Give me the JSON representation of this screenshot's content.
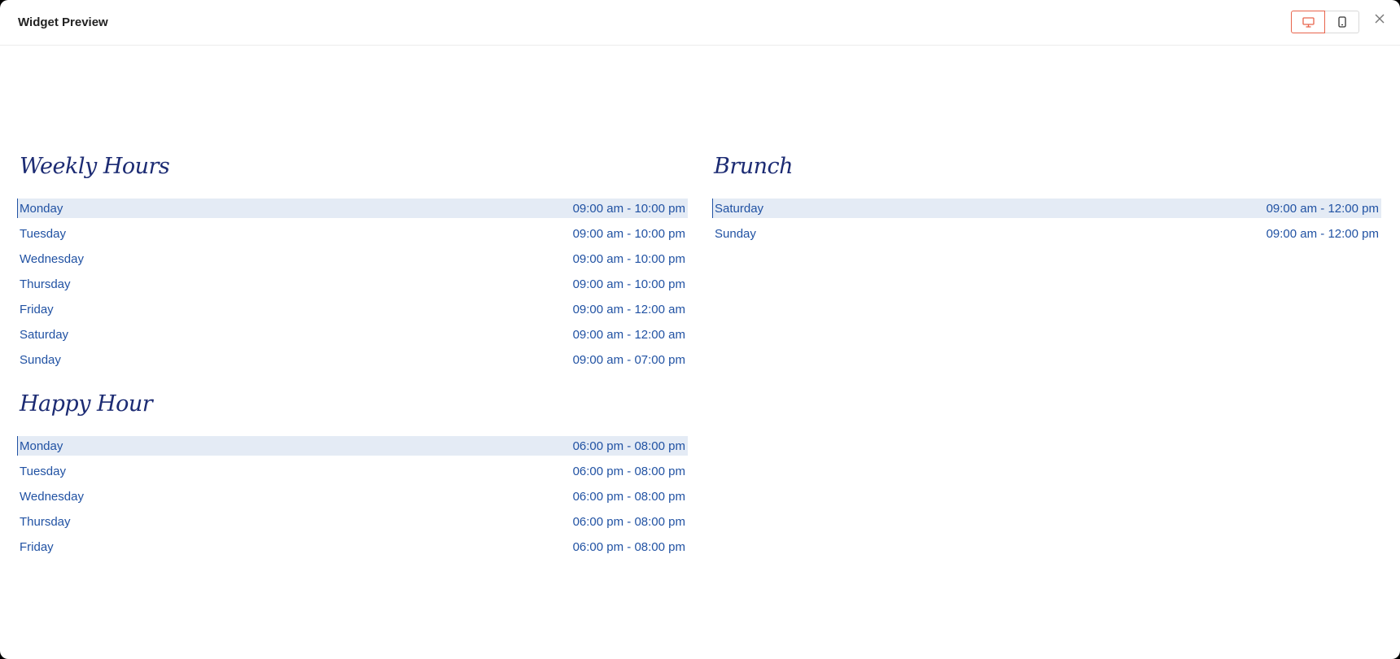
{
  "header": {
    "title": "Widget Preview",
    "desktop_icon": "desktop-icon",
    "mobile_icon": "mobile-icon",
    "close_icon": "close-icon"
  },
  "colors": {
    "accent": "#e8644c",
    "text": "#2152a3",
    "heading": "#1c2b73",
    "highlight": "#e4ebf5"
  },
  "weekly": {
    "title": "Weekly Hours",
    "rows": [
      {
        "day": "Monday",
        "time": "09:00 am - 10:00 pm"
      },
      {
        "day": "Tuesday",
        "time": "09:00 am - 10:00 pm"
      },
      {
        "day": "Wednesday",
        "time": "09:00 am - 10:00 pm"
      },
      {
        "day": "Thursday",
        "time": "09:00 am - 10:00 pm"
      },
      {
        "day": "Friday",
        "time": "09:00 am - 12:00 am"
      },
      {
        "day": "Saturday",
        "time": "09:00 am - 12:00 am"
      },
      {
        "day": "Sunday",
        "time": "09:00 am - 07:00 pm"
      }
    ]
  },
  "happy": {
    "title": "Happy Hour",
    "rows": [
      {
        "day": "Monday",
        "time": "06:00 pm - 08:00 pm"
      },
      {
        "day": "Tuesday",
        "time": "06:00 pm - 08:00 pm"
      },
      {
        "day": "Wednesday",
        "time": "06:00 pm - 08:00 pm"
      },
      {
        "day": "Thursday",
        "time": "06:00 pm - 08:00 pm"
      },
      {
        "day": "Friday",
        "time": "06:00 pm - 08:00 pm"
      }
    ]
  },
  "brunch": {
    "title": "Brunch",
    "rows": [
      {
        "day": "Saturday",
        "time": "09:00 am - 12:00 pm"
      },
      {
        "day": "Sunday",
        "time": "09:00 am - 12:00 pm"
      }
    ]
  }
}
